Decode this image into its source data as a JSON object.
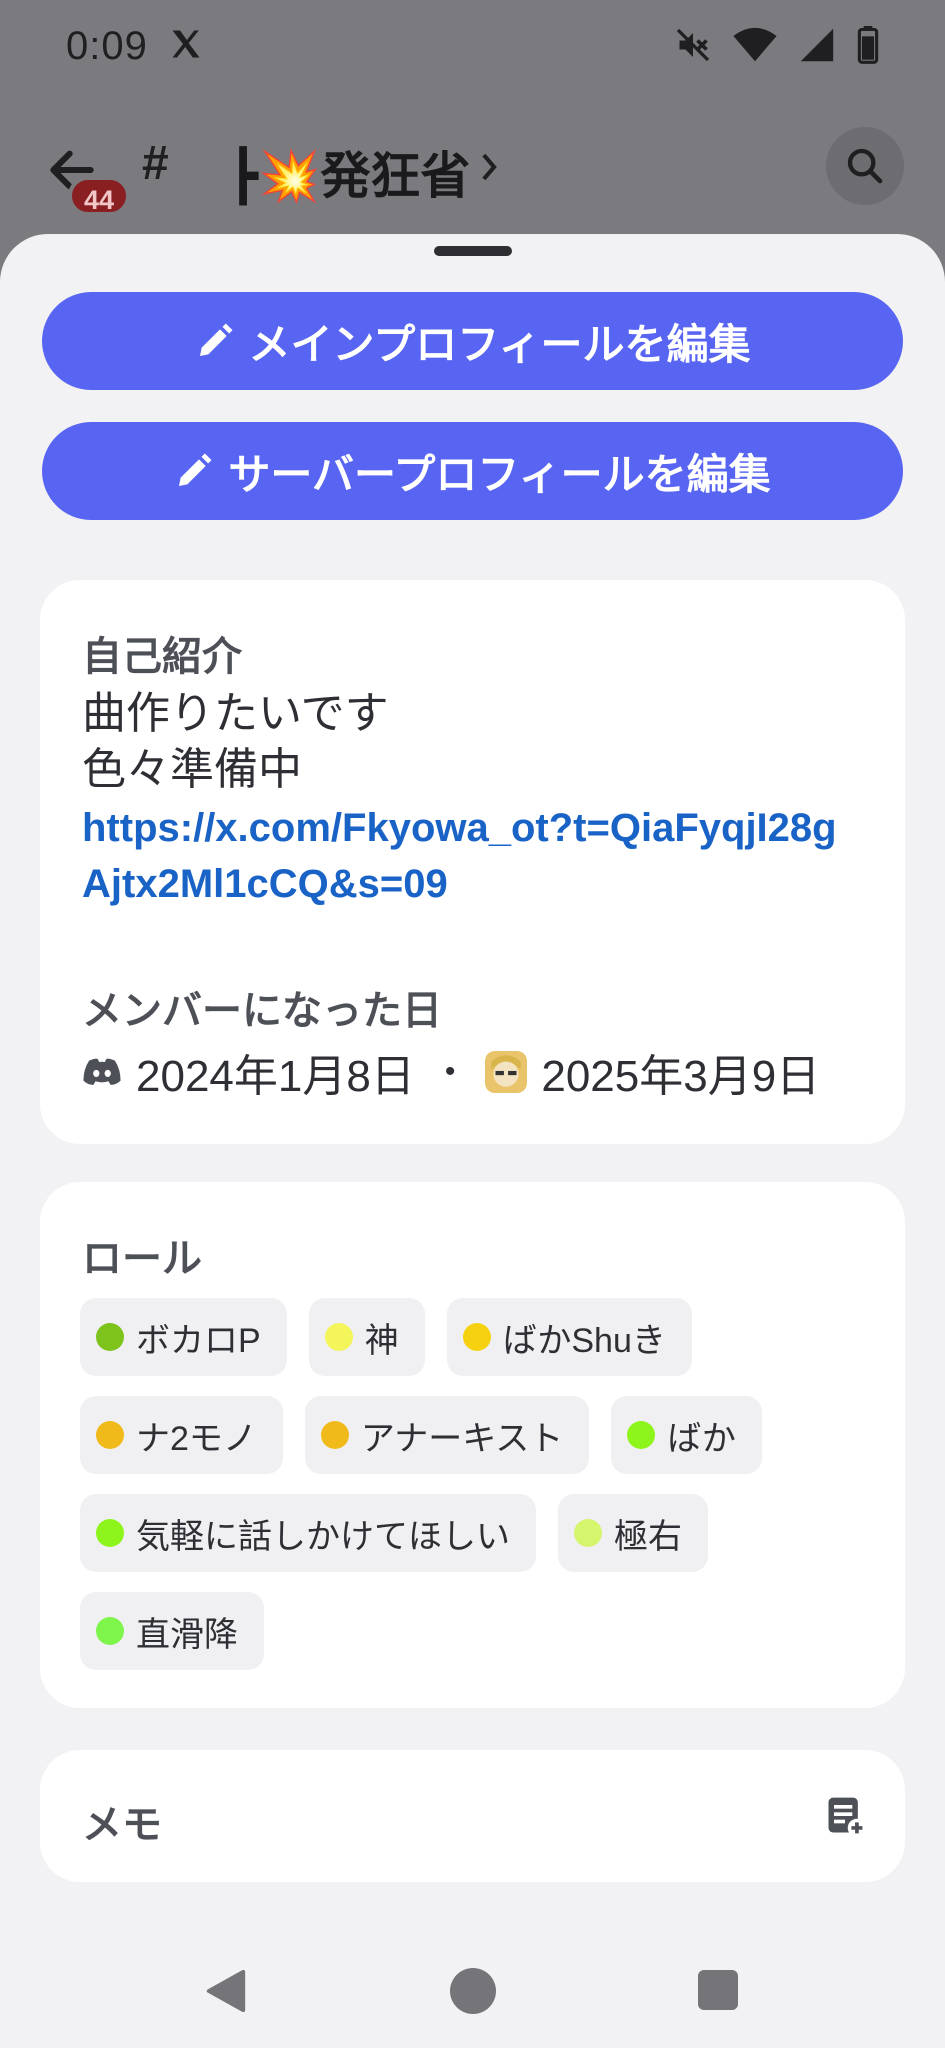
{
  "status_bar": {
    "time": "0:09",
    "icons": [
      "x-logo-icon",
      "mute-icon",
      "wifi-icon",
      "signal-icon",
      "battery-icon"
    ]
  },
  "channel_header": {
    "unread_badge": "44",
    "hash": "#",
    "channel_name": "┣💥発狂省",
    "channel_emoji": "collision-icon"
  },
  "sheet": {
    "edit_main_profile_label": "メインプロフィールを編集",
    "edit_server_profile_label": "サーバープロフィールを編集",
    "about": {
      "title": "自己紹介",
      "text": "曲作りたいです\n色々準備中",
      "link": "https://x.com/Fkyowa_ot?t=QiaFyqjI28gAjtx2Ml1cCQ&s=09"
    },
    "member_since": {
      "title": "メンバーになった日",
      "discord_date": "2024年1月8日",
      "separator": "•",
      "server_date": "2025年3月9日"
    },
    "roles": {
      "title": "ロール",
      "items": [
        {
          "name": "ボカロP",
          "color": "#7ec21c"
        },
        {
          "name": "神",
          "color": "#f4f55a"
        },
        {
          "name": "ばかShuき",
          "color": "#f5d10f"
        },
        {
          "name": "ナ2モノ",
          "color": "#f0bb1a"
        },
        {
          "name": "アナーキスト",
          "color": "#f0bb1a"
        },
        {
          "name": "ばか",
          "color": "#8ef51c"
        },
        {
          "name": "気軽に話しかけてほしい",
          "color": "#8ef51c"
        },
        {
          "name": "極右",
          "color": "#d5f56c"
        },
        {
          "name": "直滑降",
          "color": "#7ef54a"
        }
      ]
    },
    "memo": {
      "title": "メモ"
    }
  },
  "colors": {
    "accent": "#5865f2",
    "link": "#1a63c6",
    "badge": "#8a1f22"
  }
}
